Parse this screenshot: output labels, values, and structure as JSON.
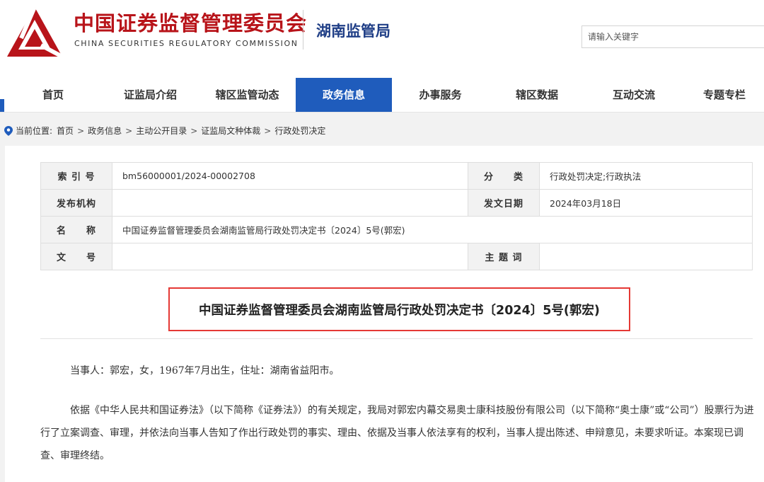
{
  "header": {
    "org_name_cn": "中国证券监督管理委员会",
    "org_name_en": "CHINA SECURITIES REGULATORY COMMISSION",
    "bureau": "湖南监管局",
    "search_placeholder": "请输入关键字",
    "logo_color": "#b8141a"
  },
  "nav": {
    "active_color": "#1f5cbc",
    "items": [
      {
        "label": "首页"
      },
      {
        "label": "证监局介绍"
      },
      {
        "label": "辖区监管动态"
      },
      {
        "label": "政务信息",
        "active": true
      },
      {
        "label": "办事服务"
      },
      {
        "label": "辖区数据"
      },
      {
        "label": "互动交流"
      },
      {
        "label": "专题专栏"
      }
    ]
  },
  "breadcrumb": {
    "prefix": "当前位置:",
    "items": [
      "首页",
      "政务信息",
      "主动公开目录",
      "证监局文种体裁",
      "行政处罚决定"
    ]
  },
  "meta": {
    "index_label": "索 引 号",
    "index_value": "bm56000001/2024-00002708",
    "category_label": "分　　类",
    "category_value": "行政处罚决定;行政执法",
    "publisher_label": "发布机构",
    "publisher_value": "",
    "date_label": "发文日期",
    "date_value": "2024年03月18日",
    "name_label": "名　　称",
    "name_value": "中国证券监督管理委员会湖南监管局行政处罚决定书〔2024〕5号(郭宏)",
    "docno_label": "文　　号",
    "docno_value": "",
    "keywords_label": "主 题 词",
    "keywords_value": ""
  },
  "document": {
    "title": "中国证券监督管理委员会湖南监管局行政处罚决定书〔2024〕5号(郭宏)",
    "highlight_color": "#e53935",
    "paragraph1": "当事人：郭宏，女，1967年7月出生，住址：湖南省益阳市。",
    "paragraph2": "依据《中华人民共和国证券法》（以下简称《证券法》）的有关规定，我局对郭宏内幕交易奥士康科技股份有限公司（以下简称“奥士康”或“公司”）股票行为进行了立案调查、审理，并依法向当事人告知了作出行政处罚的事实、理由、依据及当事人依法享有的权利，当事人提出陈述、申辩意见，未要求听证。本案现已调查、审理终结。"
  }
}
